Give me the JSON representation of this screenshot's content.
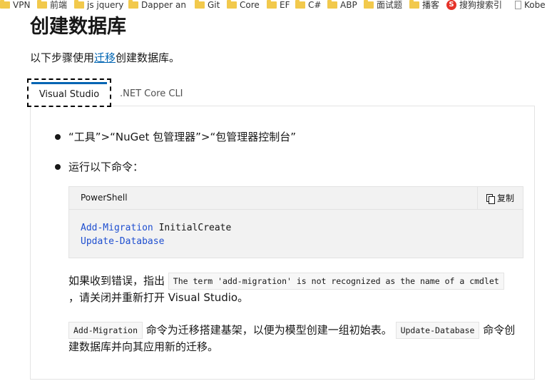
{
  "bookmarks": [
    {
      "label": "VPN",
      "icon": "folder-icon"
    },
    {
      "label": "前端",
      "icon": "folder-icon"
    },
    {
      "label": "js jquery",
      "icon": "folder-icon"
    },
    {
      "label": "Dapper an",
      "icon": "folder-icon"
    },
    {
      "label": "Git",
      "icon": "folder-icon"
    },
    {
      "label": "Core",
      "icon": "folder-icon"
    },
    {
      "label": "EF",
      "icon": "folder-icon"
    },
    {
      "label": "C#",
      "icon": "folder-icon"
    },
    {
      "label": "ABP",
      "icon": "folder-icon"
    },
    {
      "label": "面试题",
      "icon": "folder-icon"
    },
    {
      "label": "播客",
      "icon": "folder-icon"
    },
    {
      "label": "搜狗搜索引",
      "icon": "sogou-icon"
    },
    {
      "label": "Kobe",
      "icon": "document-icon"
    }
  ],
  "page": {
    "title": "创建数据库",
    "intro_prefix": "以下步骤使用",
    "intro_link": "迁移",
    "intro_suffix": "创建数据库。"
  },
  "tabs": [
    {
      "label": "Visual Studio",
      "active": true
    },
    {
      "label": ".NET Core CLI",
      "active": false
    }
  ],
  "steps": {
    "item1": "“工具”>“NuGet 包管理器”>“包管理器控制台”",
    "item2": "运行以下命令："
  },
  "code": {
    "language": "PowerShell",
    "copy_label": "复制",
    "line1_cmd": "Add-Migration",
    "line1_arg": " InitialCreate",
    "line2_cmd": "Update-Database"
  },
  "error_note": {
    "prefix": "如果收到错误，指出 ",
    "code": "The term 'add-migration' is not recognized as the name of a cmdlet",
    "suffix": "，请关闭并重新打开 Visual Studio。"
  },
  "explain": {
    "code1": "Add-Migration",
    "text1": " 命令为迁移搭建基架，以便为模型创建一组初始表。 ",
    "code2": "Update-Database",
    "text2": " 命令创建数据库并向其应用新的迁移。"
  },
  "colors": {
    "accent": "#0065b3",
    "code_keyword": "#1f4fd0",
    "text": "#171717"
  }
}
